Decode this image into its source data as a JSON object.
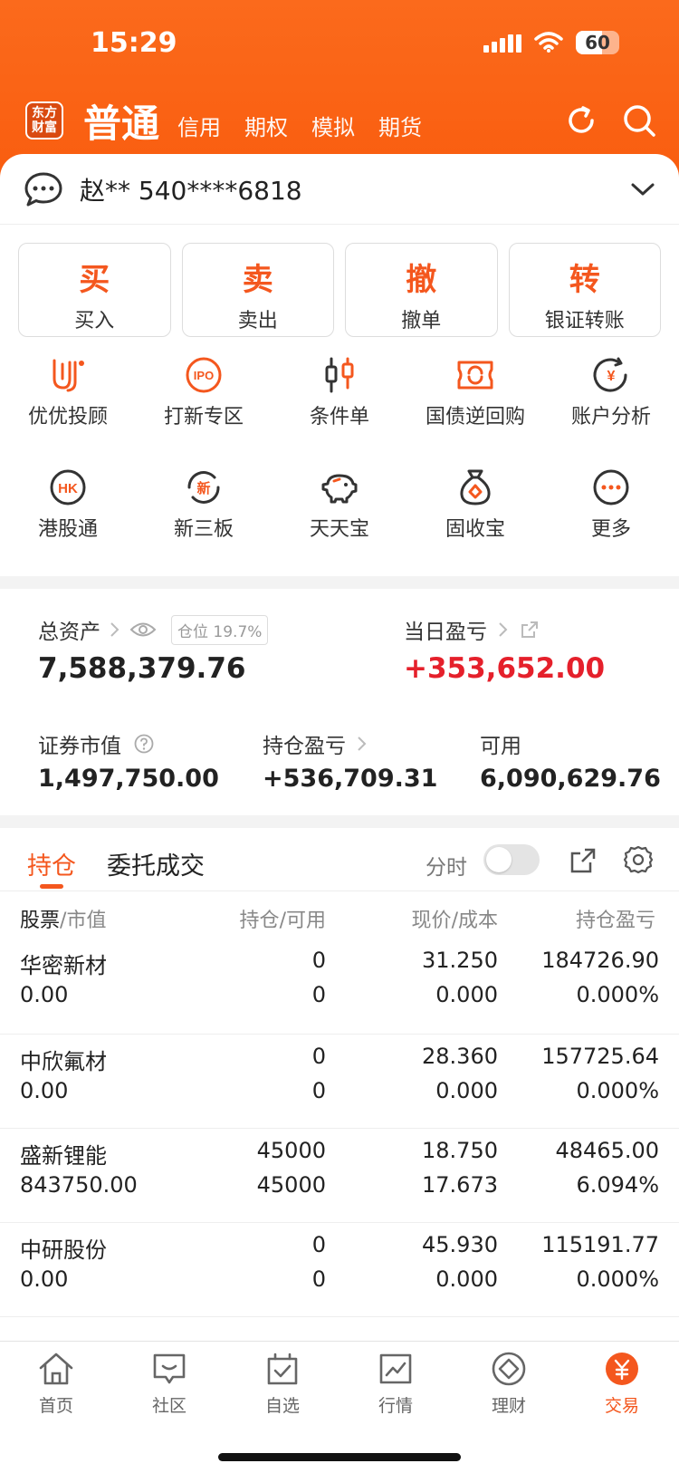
{
  "status_bar": {
    "time": "15:29",
    "battery": "60",
    "battery_level": 0.6
  },
  "header": {
    "logo_line1": "东方",
    "logo_line2": "财富",
    "main_tab": "普通",
    "tabs": [
      "信用",
      "期权",
      "模拟",
      "期货"
    ]
  },
  "account": {
    "text": "赵** 540****6818"
  },
  "actions": [
    {
      "big": "买",
      "small": "买入"
    },
    {
      "big": "卖",
      "small": "卖出"
    },
    {
      "big": "撤",
      "small": "撤单"
    },
    {
      "big": "转",
      "small": "银证转账"
    }
  ],
  "features": [
    {
      "label": "优优投顾",
      "icon": "uu-advisor-icon",
      "badge": ""
    },
    {
      "label": "打新专区",
      "icon": "ipo-icon",
      "badge": "IPO"
    },
    {
      "label": "条件单",
      "icon": "candlestick-icon",
      "badge": ""
    },
    {
      "label": "国债逆回购",
      "icon": "bond-repo-icon",
      "badge": ""
    },
    {
      "label": "账户分析",
      "icon": "account-analysis-icon",
      "badge": "¥"
    },
    {
      "label": "港股通",
      "icon": "hk-connect-icon",
      "badge": "HK"
    },
    {
      "label": "新三板",
      "icon": "neeq-icon",
      "badge": "新"
    },
    {
      "label": "天天宝",
      "icon": "piggy-bank-icon",
      "badge": ""
    },
    {
      "label": "固收宝",
      "icon": "money-bag-icon",
      "badge": ""
    },
    {
      "label": "更多",
      "icon": "more-icon",
      "badge": ""
    }
  ],
  "assets": {
    "total_label": "总资产",
    "position_label": "仓位 19.7%",
    "total_value": "7,588,379.76",
    "daily_label": "当日盈亏",
    "daily_value": "+353,652.00",
    "market_label": "证券市值",
    "market_value": "1,497,750.00",
    "holding_pl_label": "持仓盈亏",
    "holding_pl_value": "+536,709.31",
    "available_label": "可用",
    "available_value": "6,090,629.76"
  },
  "holdings": {
    "tab_active": "持仓",
    "tab_other": "委托成交",
    "timeshare_label": "分时",
    "headers": {
      "stock_a": "股票",
      "stock_b": "市值",
      "position_a": "持仓",
      "position_b": "可用",
      "price_a": "现价",
      "price_b": "成本",
      "pl": "持仓盈亏"
    },
    "rows": [
      {
        "name": "华密新材",
        "market_value": "0.00",
        "position": "0",
        "available": "0",
        "price": "31.250",
        "cost": "0.000",
        "pl": "184726.90",
        "pl_pct": "0.000%"
      },
      {
        "name": "中欣氟材",
        "market_value": "0.00",
        "position": "0",
        "available": "0",
        "price": "28.360",
        "cost": "0.000",
        "pl": "157725.64",
        "pl_pct": "0.000%"
      },
      {
        "name": "盛新锂能",
        "market_value": "843750.00",
        "position": "45000",
        "available": "45000",
        "price": "18.750",
        "cost": "17.673",
        "pl": "48465.00",
        "pl_pct": "6.094%"
      },
      {
        "name": "中研股份",
        "market_value": "0.00",
        "position": "0",
        "available": "0",
        "price": "45.930",
        "cost": "0.000",
        "pl": "115191.77",
        "pl_pct": "0.000%"
      }
    ]
  },
  "tabbar": [
    {
      "label": "首页",
      "icon": "home-icon"
    },
    {
      "label": "社区",
      "icon": "community-icon"
    },
    {
      "label": "自选",
      "icon": "watchlist-icon"
    },
    {
      "label": "行情",
      "icon": "market-chart-icon"
    },
    {
      "label": "理财",
      "icon": "wealth-icon"
    },
    {
      "label": "交易",
      "icon": "trade-icon"
    }
  ],
  "colors": {
    "accent": "#f4571e",
    "header_top": "#fb6a1c",
    "gain": "#e5202b"
  }
}
